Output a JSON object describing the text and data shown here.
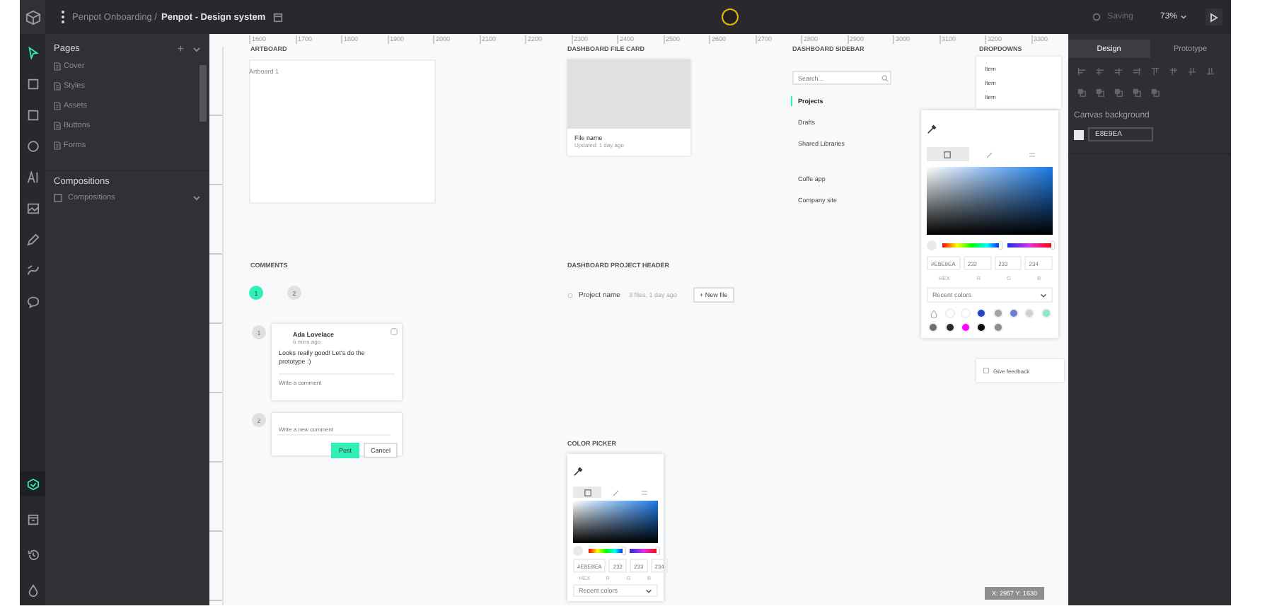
{
  "topbar": {
    "project": "Penpot Onboarding /",
    "file": "Penpot - Design system",
    "status": "Saving",
    "zoom": "73%"
  },
  "tools": [
    {
      "kind": "move",
      "selected": true
    },
    {
      "kind": "board",
      "selected": false
    },
    {
      "kind": "rect",
      "selected": false
    },
    {
      "kind": "ellipse",
      "selected": false
    },
    {
      "kind": "text",
      "selected": false
    },
    {
      "kind": "image",
      "selected": false
    },
    {
      "kind": "pen",
      "selected": false
    },
    {
      "kind": "curve",
      "selected": false
    },
    {
      "kind": "comment",
      "selected": false
    }
  ],
  "bottom_tools": [
    {
      "kind": "layers",
      "selected": true
    },
    {
      "kind": "assets",
      "selected": false
    },
    {
      "kind": "history",
      "selected": false
    },
    {
      "kind": "palette",
      "selected": false
    }
  ],
  "pages": {
    "title": "Pages",
    "add": "+",
    "items": [
      "Cover",
      "Styles",
      "Assets",
      "Buttons",
      "Forms"
    ]
  },
  "compositions": {
    "title": "Compositions",
    "items": [
      {
        "label": "Compositions",
        "expanded": false
      }
    ]
  },
  "ruler": [
    "1600",
    "1700",
    "1800",
    "1900",
    "2000",
    "2100",
    "2200",
    "2300",
    "2400",
    "2500",
    "2600",
    "2700",
    "2800",
    "2900",
    "3000",
    "3100",
    "3200",
    "3300"
  ],
  "canvas": {
    "artboard": {
      "title": "ARTBOARD",
      "name": "Artboard 1"
    },
    "file_card": {
      "title": "DASHBOARD FILE CARD",
      "name": "File name",
      "updated": "Updated: 1 day ago"
    },
    "sidebar": {
      "title": "DASHBOARD SIDEBAR",
      "search": {
        "placeholder": "Search..."
      },
      "items": [
        {
          "label": "Projects",
          "selected": true
        },
        {
          "label": "Drafts",
          "selected": false
        },
        {
          "label": "Shared Libraries",
          "selected": false
        },
        {
          "label": "Coffe app",
          "selected": false
        },
        {
          "label": "Company site",
          "selected": false
        }
      ]
    },
    "dropdowns": {
      "title": "DROPDOWNS",
      "items": [
        "Item",
        "Item",
        "Item"
      ]
    },
    "feedback": {
      "label": "Give feedback"
    },
    "comments": {
      "title": "COMMENTS",
      "bubbles": [
        {
          "label": "1",
          "selected": true
        },
        {
          "label": "2",
          "selected": false
        }
      ],
      "thread": {
        "marker": "1",
        "author": "Ada Lovelace",
        "time": "6 mins ago",
        "text": "Looks really good! Let's do the prototype :)",
        "reply": {
          "placeholder": "Write a comment"
        }
      },
      "new_comment": {
        "marker": "2",
        "placeholder": "Write a new comment",
        "post": "Post",
        "cancel": "Cancel"
      }
    },
    "project_header": {
      "title": "DASHBOARD PROJECT HEADER",
      "name": "Project name",
      "meta": "3 files, 1 day ago",
      "new_file": "+ New file"
    },
    "color_pickers": [
      {
        "title": "COLOR PICKER",
        "tabs": [
          {
            "selected": true
          },
          {
            "selected": false
          },
          {
            "selected": false
          }
        ],
        "hue": {
          "level": 0.98
        },
        "alpha": {
          "level": 1
        },
        "hex": "#E8E9EA",
        "values": [
          "232",
          "233",
          "234"
        ],
        "labels": [
          "HEX",
          "R",
          "G",
          "B"
        ],
        "recent": "Recent colors"
      },
      {
        "tabs": [
          {
            "selected": true
          },
          {
            "selected": false
          },
          {
            "selected": false
          }
        ],
        "hue": {
          "level": 0.98
        },
        "alpha": {
          "level": 1
        },
        "hex": "#E8E9EA",
        "values": [
          "232",
          "233",
          "234"
        ],
        "labels": [
          "HEX",
          "R",
          "G",
          "B"
        ],
        "recent": "Recent colors",
        "swatches": [
          {
            "kind": "none"
          },
          {
            "kind": "swatch",
            "color": "#ffffff"
          },
          {
            "kind": "swatch",
            "color": "#ffffff"
          },
          {
            "kind": "swatch",
            "color": "#1f45c4"
          },
          {
            "kind": "swatch",
            "color": "#a3a3a3"
          },
          {
            "kind": "swatch",
            "color": "#6b80c8"
          },
          {
            "kind": "swatch",
            "color": "#cfcfcf"
          },
          {
            "kind": "swatch",
            "color": "#8ee6c8"
          },
          {
            "kind": "swatch",
            "color": "#6e6e6e"
          },
          {
            "kind": "swatch",
            "color": "#2a2a2a"
          },
          {
            "kind": "swatch",
            "color": "#ff00ff"
          },
          {
            "kind": "swatch",
            "color": "#0a0a0a"
          },
          {
            "kind": "swatch",
            "color": "#8c8c8c"
          }
        ]
      }
    ],
    "coordinates": "X: 2957 Y: 1630"
  },
  "right_panel": {
    "tabs": [
      {
        "label": "Design",
        "selected": true
      },
      {
        "label": "Prototype",
        "selected": false
      }
    ],
    "canvas_background": {
      "label": "Canvas background",
      "value": "E8E9EA"
    }
  }
}
